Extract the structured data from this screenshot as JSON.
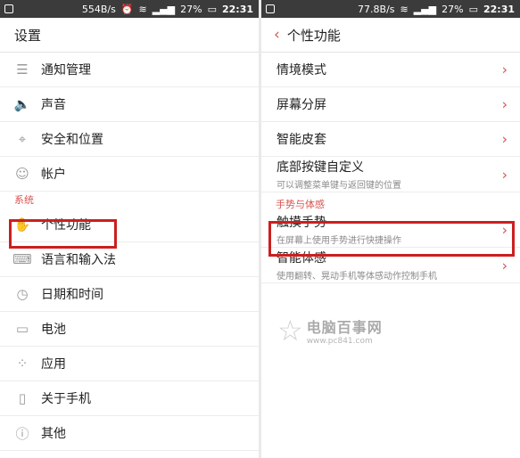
{
  "left": {
    "status": {
      "speed": "554B/s",
      "battery": "27%",
      "time": "22:31"
    },
    "title": "设置",
    "items_top": [
      {
        "label": "通知管理",
        "icon": "list-icon"
      },
      {
        "label": "声音",
        "icon": "speaker-icon"
      },
      {
        "label": "安全和位置",
        "icon": "location-pin-icon"
      },
      {
        "label": "帐户",
        "icon": "person-icon"
      }
    ],
    "section": "系统",
    "items_system": [
      {
        "label": "个性功能",
        "icon": "hand-icon",
        "highlighted": true
      },
      {
        "label": "语言和输入法",
        "icon": "keyboard-icon"
      },
      {
        "label": "日期和时间",
        "icon": "clock-icon"
      },
      {
        "label": "电池",
        "icon": "battery-icon"
      },
      {
        "label": "应用",
        "icon": "apps-grid-icon"
      },
      {
        "label": "关于手机",
        "icon": "phone-icon"
      },
      {
        "label": "其他",
        "icon": "info-icon"
      }
    ]
  },
  "right": {
    "status": {
      "speed": "77.8B/s",
      "battery": "27%",
      "time": "22:31"
    },
    "title": "个性功能",
    "items": [
      {
        "label": "情境模式"
      },
      {
        "label": "屏幕分屏"
      },
      {
        "label": "智能皮套"
      },
      {
        "label": "底部按键自定义",
        "sub": "可以调整菜单键与返回键的位置"
      }
    ],
    "section": "手势与体感",
    "items_gesture": [
      {
        "label": "触摸手势",
        "sub": "在屏幕上使用手势进行快捷操作",
        "highlighted": true
      },
      {
        "label": "智能体感",
        "sub": "使用翻转、晃动手机等体感动作控制手机"
      }
    ]
  },
  "watermark": {
    "title": "电脑百事网",
    "url": "www.pc841.com"
  },
  "colors": {
    "accent": "#d9534f",
    "highlight": "#cc1f1f",
    "statusbar": "#3b3b3b"
  }
}
